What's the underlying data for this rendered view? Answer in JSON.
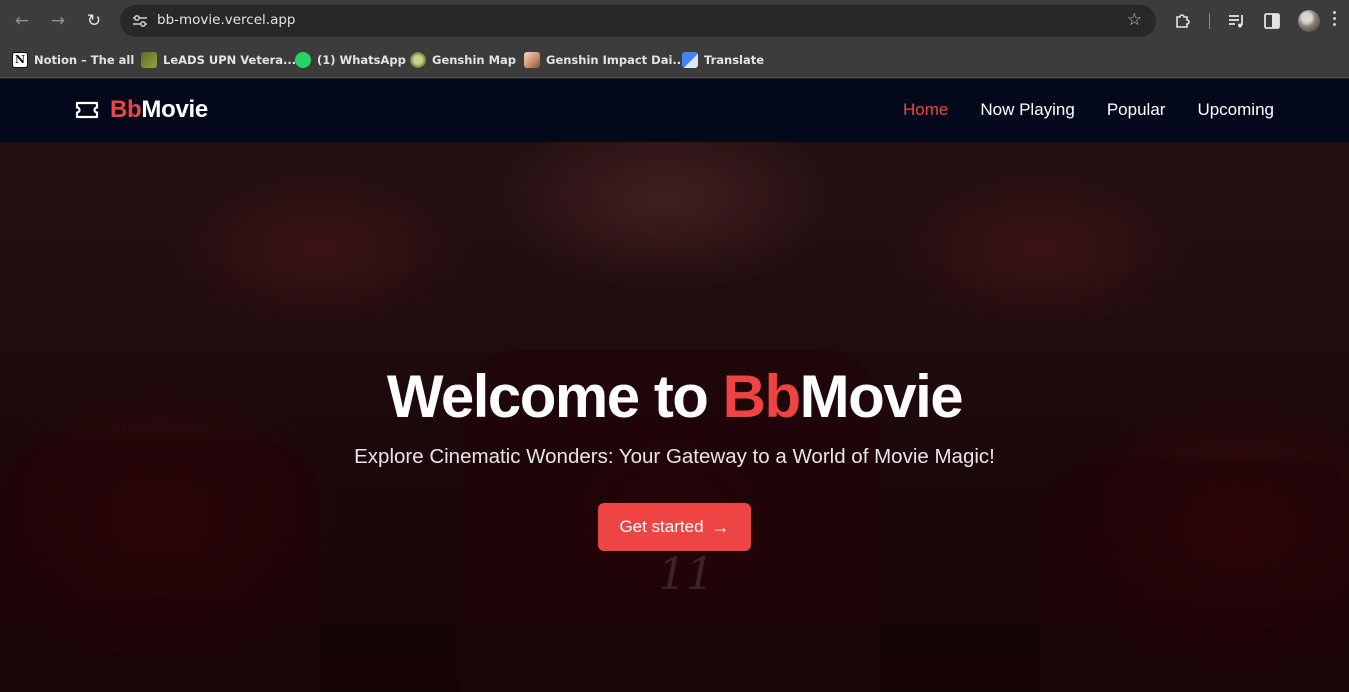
{
  "browser": {
    "url": "bb-movie.vercel.app",
    "bookmarks": [
      {
        "label": "Notion – The all",
        "icon": "notion-icon"
      },
      {
        "label": "LeADS UPN Vetera...",
        "icon": "leads-icon"
      },
      {
        "label": "(1) WhatsApp",
        "icon": "whatsapp-icon"
      },
      {
        "label": "Genshin Map",
        "icon": "genshin-map-icon"
      },
      {
        "label": "Genshin Impact Dai...",
        "icon": "genshin-impact-icon"
      },
      {
        "label": "Translate",
        "icon": "translate-icon"
      }
    ]
  },
  "site": {
    "brand_prefix": "Bb",
    "brand_suffix": "Movie",
    "accent_color": "#ef4444",
    "nav": [
      {
        "label": "Home",
        "active": true
      },
      {
        "label": "Now Playing",
        "active": false
      },
      {
        "label": "Popular",
        "active": false
      },
      {
        "label": "Upcoming",
        "active": false
      }
    ]
  },
  "hero": {
    "title_prefix": "Welcome to ",
    "title_brand_accent": "Bb",
    "title_brand_rest": "Movie",
    "subtitle": "Explore Cinematic Wonders: Your Gateway to a World of Movie Magic!",
    "cta_label": "Get started",
    "seat_number": "11"
  }
}
